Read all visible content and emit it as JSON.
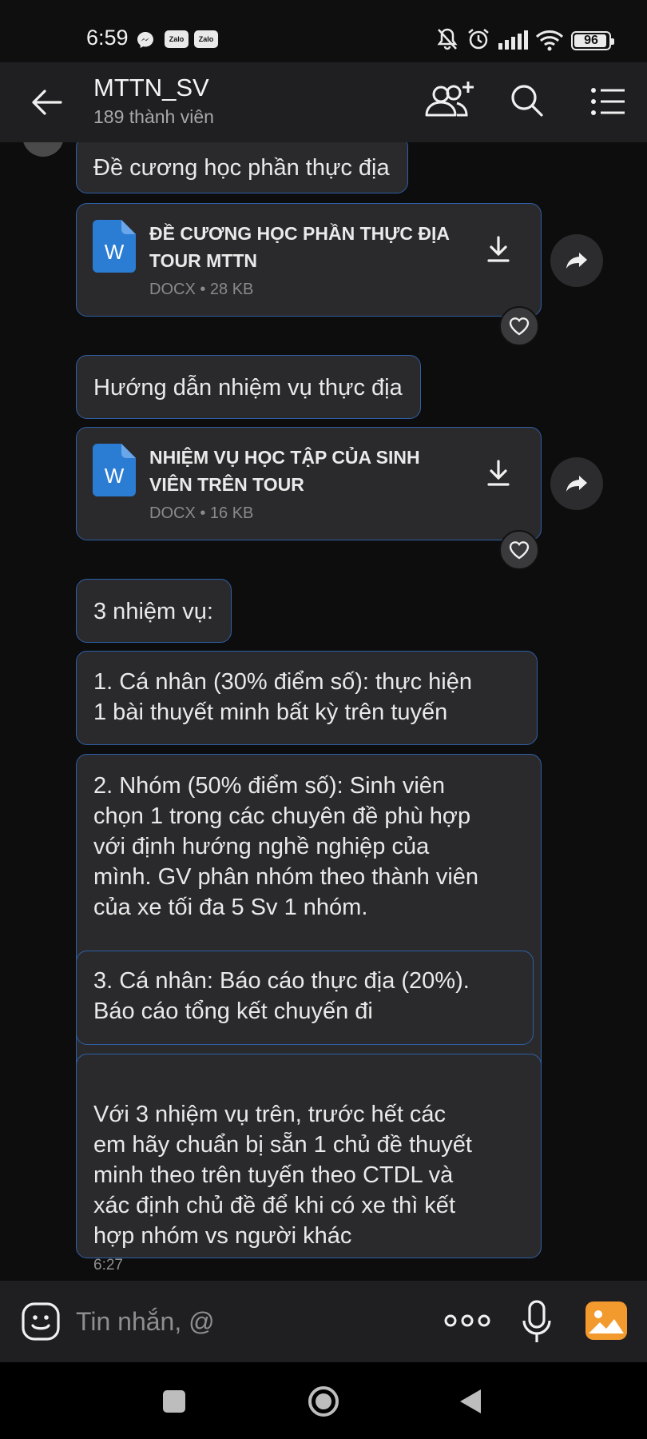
{
  "status_bar": {
    "time": "6:59",
    "zalo_badge_1": "Zalo",
    "zalo_badge_2": "Zalo",
    "battery": "96",
    "icons": [
      "messenger-icon",
      "zalo-icon",
      "zalo-icon",
      "mute-icon",
      "alarm-icon",
      "signal-icon",
      "wifi-icon",
      "battery-icon"
    ]
  },
  "header": {
    "title": "MTTN_SV",
    "subtitle": "189 thành viên",
    "icons": [
      "back-arrow-icon",
      "add-member-icon",
      "search-icon",
      "menu-list-icon"
    ]
  },
  "messages": [
    {
      "type": "text",
      "text": "Đề cương học phần thực địa"
    },
    {
      "type": "file",
      "name": "ĐỀ CƯƠNG HỌC PHẦN THỰC ĐỊA TOUR MTTN",
      "meta": "DOCX • 28 KB"
    },
    {
      "type": "text",
      "text": "Hướng dẫn nhiệm vụ thực địa"
    },
    {
      "type": "file",
      "name": "NHIỆM VỤ HỌC TẬP CỦA SINH VIÊN TRÊN TOUR",
      "meta": "DOCX • 16 KB"
    },
    {
      "type": "text",
      "text": "3 nhiệm vụ:"
    },
    {
      "type": "text",
      "text": "1. Cá nhân (30% điểm số): thực hiện\n1 bài thuyết minh bất kỳ trên tuyến"
    },
    {
      "type": "text",
      "text": "2. Nhóm (50% điểm số): Sinh viên\nchọn 1 trong các chuyên đề phù hợp\nvới định hướng nghề nghiệp của\nmình. GV phân nhóm theo thành viên\ncủa xe tối đa 5 Sv 1 nhóm."
    },
    {
      "type": "text",
      "text": "3. Cá nhân: Báo cáo thực địa (20%).\nBáo cáo tổng kết chuyến đi"
    },
    {
      "type": "text",
      "text": "Với 3 nhiệm vụ trên, trước hết các\nem hãy chuẩn bị sẵn 1 chủ đề thuyết\nminh theo trên tuyến theo CTDL và\nxác định chủ đề để khi có xe thì kết\nhợp nhóm vs người khác",
      "time": "6:27"
    }
  ],
  "composer": {
    "placeholder": "Tin nhắn, @",
    "icons": [
      "emoji-icon",
      "more-options-icon",
      "microphone-icon",
      "gallery-icon"
    ]
  },
  "navbar": {
    "icons": [
      "recent-apps-icon",
      "home-icon",
      "back-icon"
    ]
  },
  "colors": {
    "background": "#0d0d0e",
    "bubble": "#2a2a2c",
    "bubble_border": "#2f5fa6",
    "header": "#1f1f21",
    "word_blue": "#2b7cd3",
    "gallery_orange": "#f29a2e"
  }
}
